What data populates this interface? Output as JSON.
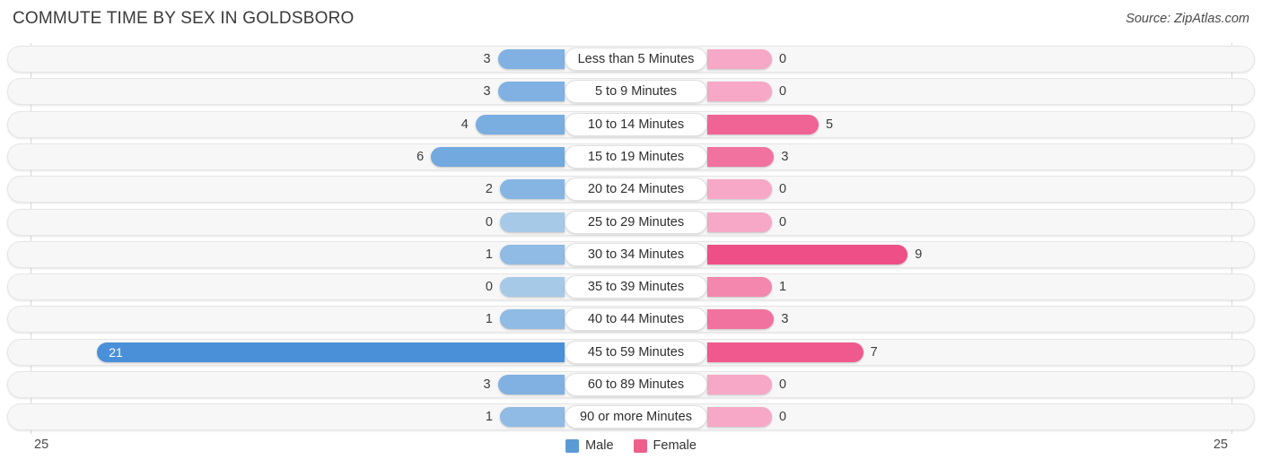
{
  "header": {
    "title": "COMMUTE TIME BY SEX IN GOLDSBORO",
    "source": "Source: ZipAtlas.com"
  },
  "legend": {
    "items": [
      {
        "label": "Male",
        "color": "#5b9bd5"
      },
      {
        "label": "Female",
        "color": "#ee5f8c"
      }
    ]
  },
  "axis": {
    "left_end": "25",
    "right_end": "25",
    "max": 25
  },
  "chart_data": {
    "type": "bar",
    "orientation": "horizontal",
    "style": "diverging-bidirectional",
    "title": "COMMUTE TIME BY SEX IN GOLDSBORO",
    "xlabel": "",
    "ylabel": "",
    "xlim": [
      25,
      25
    ],
    "grid": false,
    "legend_position": "bottom-center",
    "categories": [
      "Less than 5 Minutes",
      "5 to 9 Minutes",
      "10 to 14 Minutes",
      "15 to 19 Minutes",
      "20 to 24 Minutes",
      "25 to 29 Minutes",
      "30 to 34 Minutes",
      "35 to 39 Minutes",
      "40 to 44 Minutes",
      "45 to 59 Minutes",
      "60 to 89 Minutes",
      "90 or more Minutes"
    ],
    "series": [
      {
        "name": "Male",
        "side": "left",
        "values": [
          3,
          3,
          4,
          6,
          2,
          0,
          1,
          0,
          1,
          21,
          3,
          1
        ]
      },
      {
        "name": "Female",
        "side": "right",
        "values": [
          0,
          0,
          5,
          3,
          0,
          0,
          9,
          1,
          3,
          7,
          0,
          0
        ]
      }
    ]
  },
  "rows": [
    {
      "category": "Less than 5 Minutes",
      "male": "3",
      "female": "0"
    },
    {
      "category": "5 to 9 Minutes",
      "male": "3",
      "female": "0"
    },
    {
      "category": "10 to 14 Minutes",
      "male": "4",
      "female": "5"
    },
    {
      "category": "15 to 19 Minutes",
      "male": "6",
      "female": "3"
    },
    {
      "category": "20 to 24 Minutes",
      "male": "2",
      "female": "0"
    },
    {
      "category": "25 to 29 Minutes",
      "male": "0",
      "female": "0"
    },
    {
      "category": "30 to 34 Minutes",
      "male": "1",
      "female": "9"
    },
    {
      "category": "35 to 39 Minutes",
      "male": "0",
      "female": "1"
    },
    {
      "category": "40 to 44 Minutes",
      "male": "1",
      "female": "3"
    },
    {
      "category": "45 to 59 Minutes",
      "male": "21",
      "female": "7"
    },
    {
      "category": "60 to 89 Minutes",
      "male": "3",
      "female": "0"
    },
    {
      "category": "90 or more Minutes",
      "male": "1",
      "female": "0"
    }
  ]
}
